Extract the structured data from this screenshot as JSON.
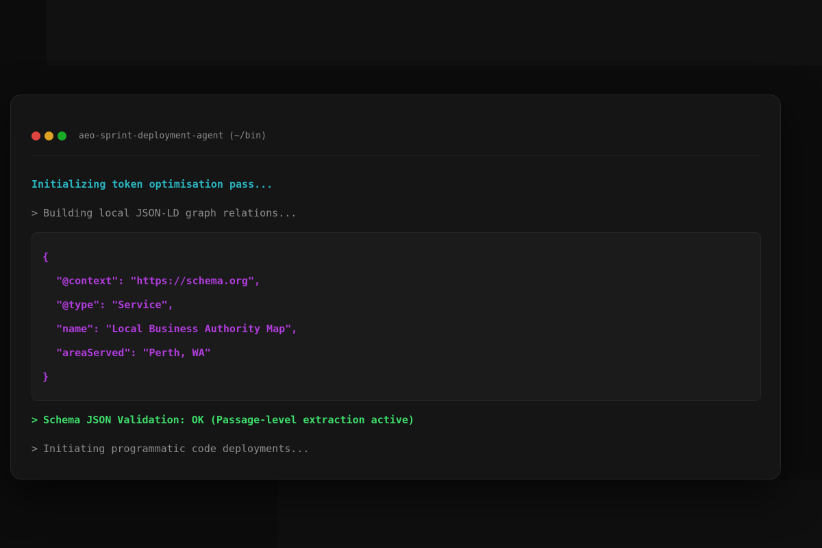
{
  "window": {
    "title": "aeo-sprint-deployment-agent (~/bin)",
    "controls": [
      {
        "name": "close",
        "color": "#e0443e"
      },
      {
        "name": "minimize",
        "color": "#dea123"
      },
      {
        "name": "maximize",
        "color": "#1aab29"
      }
    ]
  },
  "colors": {
    "cyan": "#2bb3c0",
    "gray": "#8c8c8c",
    "magenta": "#b03cdc",
    "green": "#3ddc6a"
  },
  "lines": {
    "init": "Initializing token optimisation pass...",
    "build_prompt": ">",
    "build": "Building local JSON-LD graph relations...",
    "validation_prompt": ">",
    "validation": "Schema JSON Validation: OK (Passage-level extraction active)",
    "deploy_prompt": ">",
    "deploy": "Initiating programmatic code deployments..."
  },
  "code": [
    "{",
    "\"@context\": \"https://schema.org\",",
    "\"@type\": \"Service\",",
    "\"name\": \"Local Business Authority Map\",",
    "\"areaServed\": \"Perth, WA\"",
    "}"
  ]
}
